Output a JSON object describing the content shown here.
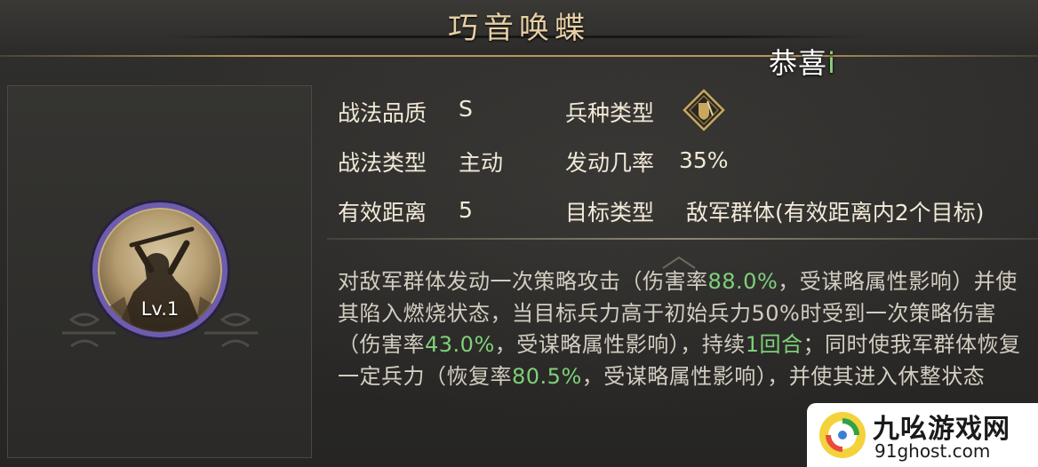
{
  "header": {
    "title": "巧音唤蝶",
    "congrats": "恭喜",
    "congrats_tail": "i"
  },
  "skill": {
    "level": "Lv.1"
  },
  "attributes": {
    "quality_label": "战法品质",
    "quality_value": "S",
    "troop_label": "兵种类型",
    "type_label": "战法类型",
    "type_value": "主动",
    "rate_label": "发动几率",
    "rate_value": "35%",
    "range_label": "有效距离",
    "range_value": "5",
    "target_label": "目标类型",
    "target_value": "敌军群体(有效距离内2个目标)"
  },
  "description": {
    "p1": "对敌军群体发动一次策略攻击（伤害率",
    "v1": "88.0%",
    "p2": "，受谋略属性影响）并使其陷入燃烧状态，当目标兵力高于初始兵力50%时受到一次策略伤害（伤害率",
    "v2": "43.0%",
    "p3": "，受谋略属性影响），持续",
    "v3": "1回合",
    "p4": "；同时使我军群体恢复一定兵力（恢复率",
    "v4": "80.5%",
    "p5": "，受谋略属性影响），并使其进入休整状态"
  },
  "watermark": {
    "name": "九吆游戏网",
    "url": "91ghost.com"
  },
  "colors": {
    "title": "#e6cfa4",
    "highlight": "#7fd07a",
    "medal_ring": "#6e5cae",
    "troop_icon": "#c9a85e"
  },
  "icons": {
    "troop": "shield-diamond-icon",
    "skill": "warrior-portrait-icon"
  }
}
